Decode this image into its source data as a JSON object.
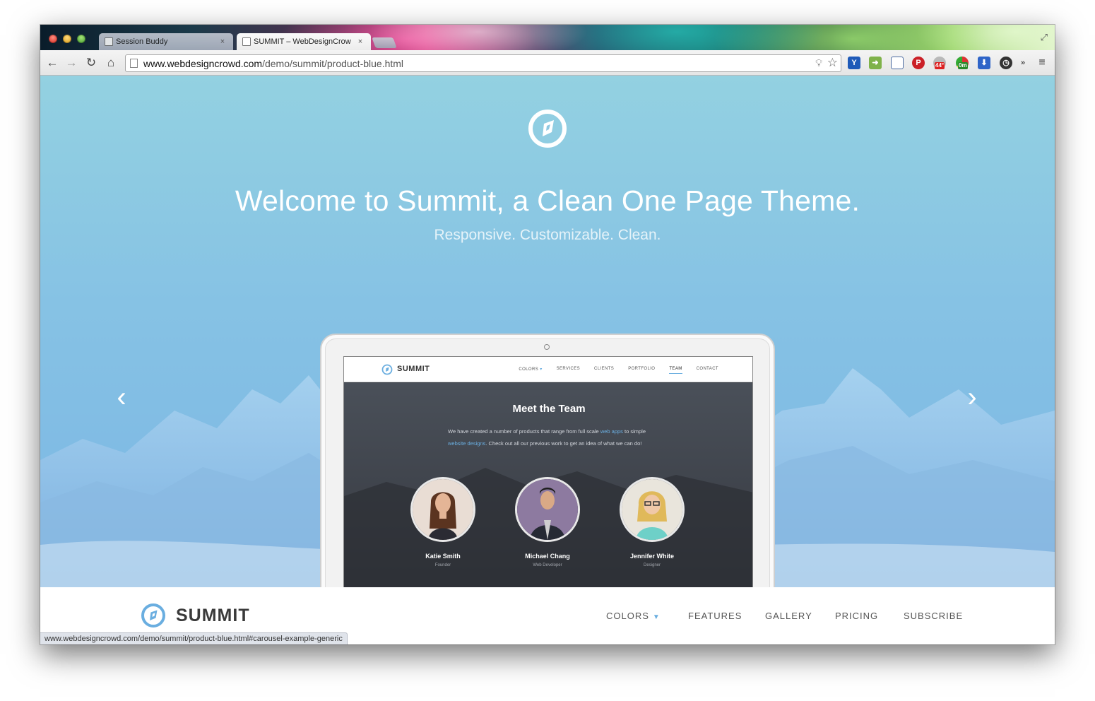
{
  "browser": {
    "tabs": [
      {
        "title": "Session Buddy",
        "close": "×"
      },
      {
        "title": "SUMMIT – WebDesignCrow",
        "close": "×"
      }
    ],
    "url_host": "www.webdesigncrowd.com",
    "url_path": "/demo/summit/product-blue.html",
    "nav": {
      "back": "←",
      "forward": "→",
      "reload": "↻",
      "home": "⌂"
    },
    "extensions": [
      {
        "name": "pinterest-icon",
        "color": "#cb2027"
      },
      {
        "name": "weather-badge",
        "label": "44°"
      },
      {
        "name": "timer-badge",
        "label": "0m"
      }
    ],
    "more": "»",
    "menu": "≡",
    "status_url": "www.webdesigncrowd.com/demo/summit/product-blue.html#carousel-example-generic"
  },
  "hero": {
    "title": "Welcome to Summit, a Clean One Page Theme.",
    "subtitle": "Responsive. Customizable. Clean.",
    "prev": "‹",
    "next": "›"
  },
  "mockup": {
    "brand": "SUMMIT",
    "menu": [
      "COLORS",
      "SERVICES",
      "CLIENTS",
      "PORTFOLIO",
      "TEAM",
      "CONTACT"
    ],
    "active": "TEAM",
    "heading": "Meet the Team",
    "desc_a": "We have created a number of products that range from full scale ",
    "desc_link1": "web apps",
    "desc_b": " to simple ",
    "desc_link2": "website designs",
    "desc_c": ". Check out all our previous work to get an idea of what we can do!",
    "team": [
      {
        "name": "Katie Smith",
        "role": "Founder"
      },
      {
        "name": "Michael Chang",
        "role": "Web Developer"
      },
      {
        "name": "Jennifer White",
        "role": "Designer"
      }
    ]
  },
  "nav": {
    "brand": "SUMMIT",
    "items": [
      "COLORS",
      "FEATURES",
      "GALLERY",
      "PRICING",
      "SUBSCRIBE"
    ]
  },
  "colors": {
    "accent": "#6aaee0",
    "hero_top": "#93d1e1",
    "hero_bottom": "#7bb6e4"
  }
}
